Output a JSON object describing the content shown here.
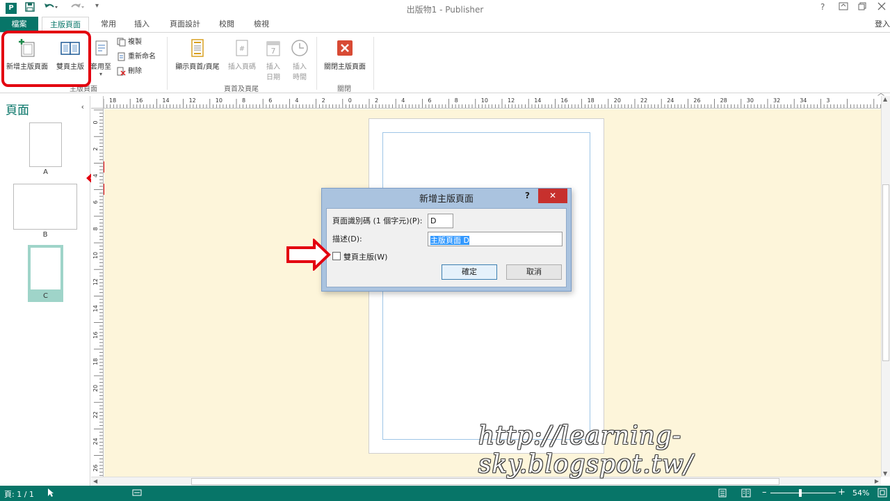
{
  "app": {
    "icon_letter": "P",
    "window_title": "出版物1 - Publisher",
    "help_button": "?",
    "signin": "登入"
  },
  "tabs": [
    {
      "label": "檔案"
    },
    {
      "label": "主版頁面"
    },
    {
      "label": "常用"
    },
    {
      "label": "插入"
    },
    {
      "label": "頁面設計"
    },
    {
      "label": "校閱"
    },
    {
      "label": "檢視"
    }
  ],
  "ribbon": {
    "master_group": {
      "label": "主版頁面",
      "add_master": "新增主版頁面",
      "two_page_master": "雙頁主版",
      "apply_to": "套用至",
      "duplicate": "複製",
      "rename": "重新命名",
      "delete": "刪除"
    },
    "header_footer_group": {
      "label": "頁首及頁尾",
      "show_header_footer": "顯示頁首/頁尾",
      "insert_page_number": "插入頁碼",
      "insert_date_line1": "插入",
      "insert_date_line2": "日期",
      "insert_time_line1": "插入",
      "insert_time_line2": "時間"
    },
    "close_group": {
      "label": "關閉",
      "close_master": "關閉主版頁面"
    }
  },
  "pages_pane": {
    "title": "頁面",
    "pages": [
      {
        "label": "A"
      },
      {
        "label": "B"
      },
      {
        "label": "C"
      }
    ]
  },
  "rulers": {
    "top_ticks": [
      "18",
      "16",
      "14",
      "12",
      "10",
      "8",
      "6",
      "4",
      "2",
      "0",
      "2",
      "4",
      "6",
      "8",
      "10",
      "12",
      "14",
      "16",
      "18",
      "20",
      "22",
      "24",
      "26",
      "28",
      "30",
      "32",
      "34",
      "3"
    ],
    "left_ticks": [
      "0",
      "2",
      "4",
      "6",
      "8",
      "10",
      "12",
      "14",
      "16",
      "18",
      "20",
      "22",
      "24",
      "26"
    ]
  },
  "dialog": {
    "title": "新增主版頁面",
    "page_id_label": "頁面識別碼 (1 個字元)(P):",
    "page_id_value": "D",
    "description_label": "描述(D):",
    "description_value": "主版頁面 D",
    "two_page_label": "雙頁主版(W)",
    "two_page_checked": false,
    "ok_button": "確定",
    "cancel_button": "取消"
  },
  "status_bar": {
    "page_indicator": "頁: 1 / 1",
    "zoom": "54%"
  },
  "watermark": "http://learning-sky.blogspot.tw/",
  "colors": {
    "accent": "#077568",
    "highlight": "#e3000f",
    "workspace": "#fdf5da",
    "dialog_frame": "#aac3df",
    "close_button": "#c7302d"
  }
}
